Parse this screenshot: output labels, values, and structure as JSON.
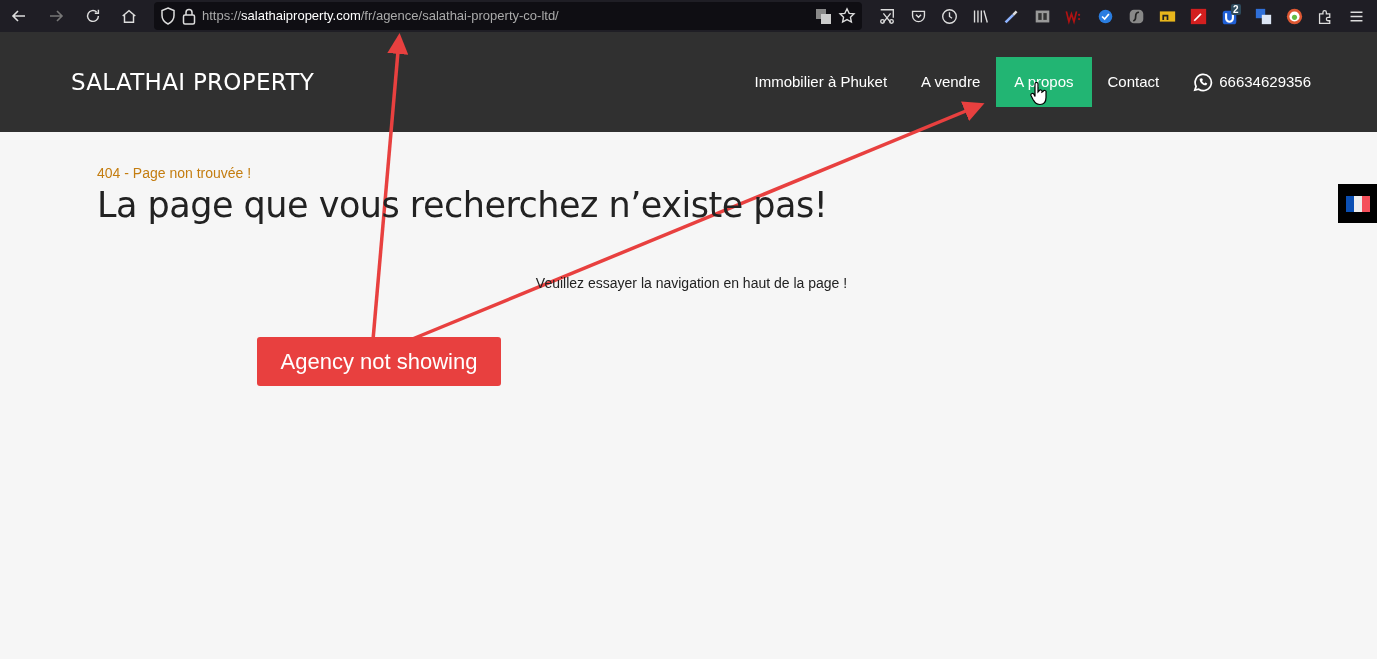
{
  "browser": {
    "url_scheme": "https://",
    "url_host": "salathaiproperty.com",
    "url_path": "/fr/agence/salathai-property-co-ltd/",
    "extension_badge": "2"
  },
  "header": {
    "logo": "SALATHAI PROPERTY",
    "nav": [
      {
        "label": "Immobilier à Phuket",
        "selected": false
      },
      {
        "label": "A vendre",
        "selected": false
      },
      {
        "label": "A propos",
        "selected": true
      },
      {
        "label": "Contact",
        "selected": false
      }
    ],
    "phone": "66634629356"
  },
  "content": {
    "error_code": "404 - Page non trouvée !",
    "heading": "La page que vous recherchez n’existe pas!",
    "hint": "Veuillez essayer la navigation en haut de la page !"
  },
  "annotation": {
    "label": "Agency not showing"
  }
}
